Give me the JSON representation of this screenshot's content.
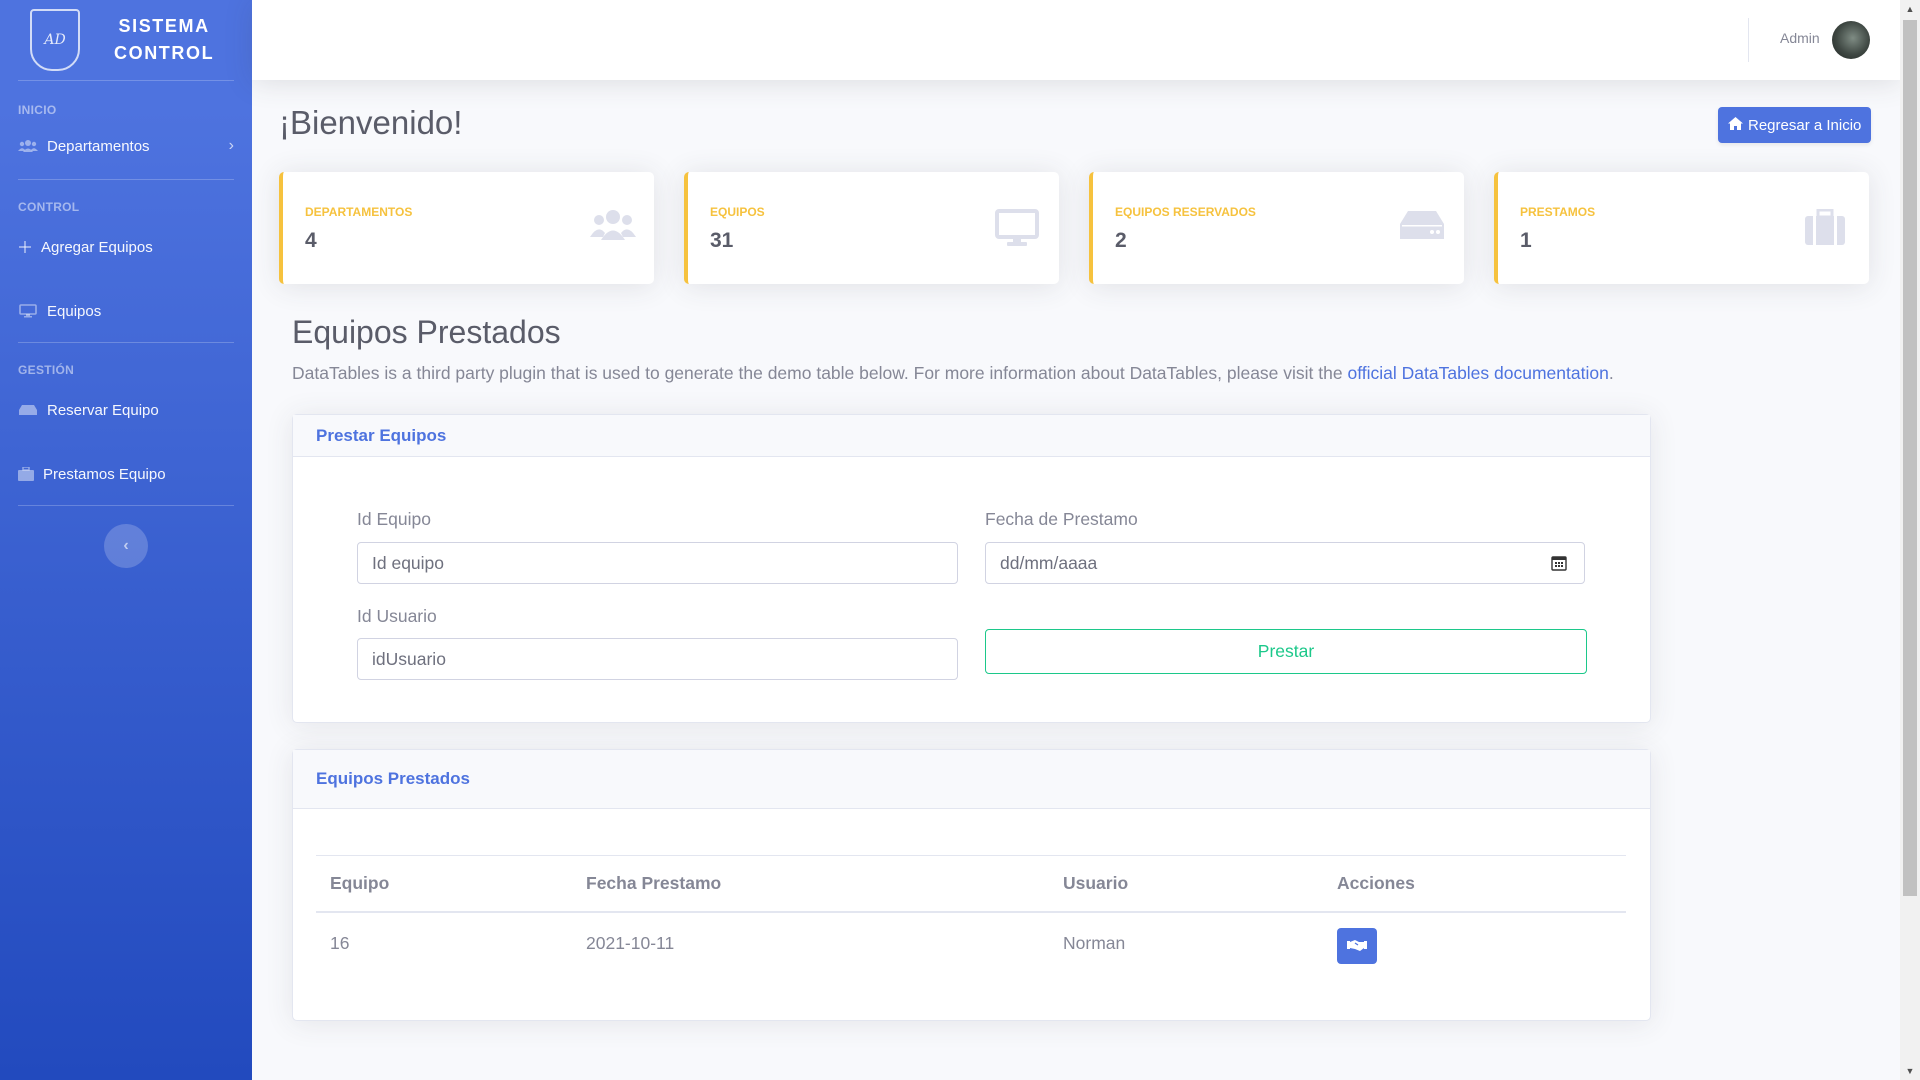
{
  "sidebar": {
    "brand_line1": "SISTEMA",
    "brand_line2": "CONTROL",
    "logo_text": "AD",
    "sections": [
      {
        "heading": "INICIO",
        "items": [
          {
            "label": "Departamentos",
            "icon": "users-icon",
            "has_chevron": true
          }
        ]
      },
      {
        "heading": "CONTROL",
        "items": [
          {
            "label": "Agregar Equipos",
            "icon": "plus-icon"
          },
          {
            "label": "Equipos",
            "icon": "desktop-icon"
          }
        ]
      },
      {
        "heading": "GESTIÓN",
        "items": [
          {
            "label": "Reservar Equipo",
            "icon": "hdd-icon"
          },
          {
            "label": "Prestamos Equipo",
            "icon": "briefcase-icon"
          }
        ]
      }
    ],
    "gradient_top": "#4e73df",
    "gradient_bottom": "#224abe"
  },
  "topbar": {
    "user_name": "Admin"
  },
  "page": {
    "title": "¡Bienvenido!",
    "home_button": "Regresar a Inicio"
  },
  "stats": [
    {
      "label": "DEPARTAMENTOS",
      "value": "4",
      "icon": "users-icon"
    },
    {
      "label": "EQUIPOS",
      "value": "31",
      "icon": "desktop-icon"
    },
    {
      "label": "EQUIPOS RESERVADOS",
      "value": "2",
      "icon": "hdd-icon"
    },
    {
      "label": "PRESTAMOS",
      "value": "1",
      "icon": "briefcase-icon"
    }
  ],
  "section": {
    "title": "Equipos Prestados",
    "desc_prefix": "DataTables is a third party plugin that is used to generate the demo table below. For more information about DataTables, please visit the ",
    "desc_link": "official DataTables documentation",
    "desc_suffix": "."
  },
  "form": {
    "header": "Prestar Equipos",
    "id_equipo_label": "Id Equipo",
    "id_equipo_placeholder": "Id equipo",
    "fecha_label": "Fecha de Prestamo",
    "fecha_placeholder": "dd/mm/aaaa",
    "id_usuario_label": "Id Usuario",
    "id_usuario_placeholder": "idUsuario",
    "submit_label": "Prestar"
  },
  "table": {
    "header": "Equipos Prestados",
    "columns": [
      "Equipo",
      "Fecha Prestamo",
      "Usuario",
      "Acciones"
    ],
    "rows": [
      {
        "equipo": "16",
        "fecha": "2021-10-11",
        "usuario": "Norman",
        "action_icon": "handshake-icon"
      }
    ]
  },
  "colors": {
    "primary": "#4e73df",
    "warning": "#f6c23e",
    "success": "#1cc88a"
  }
}
